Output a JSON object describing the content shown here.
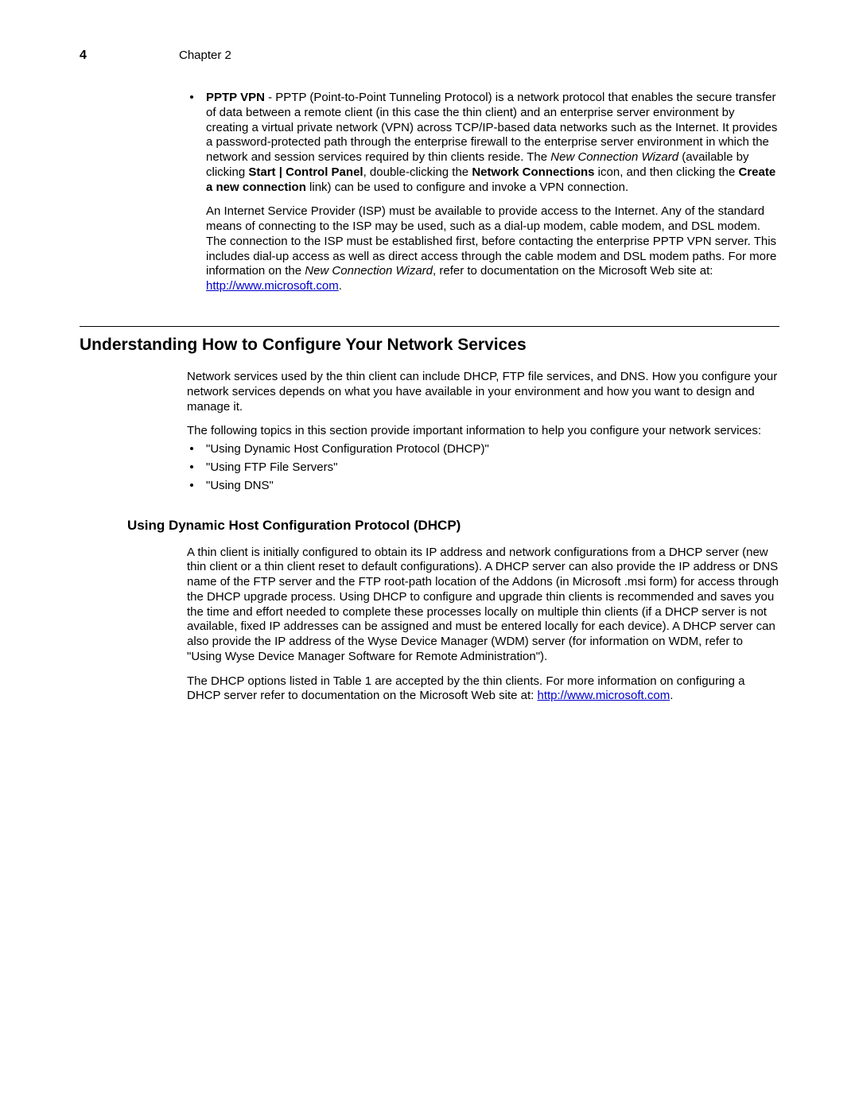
{
  "header": {
    "page_number": "4",
    "chapter_label": "Chapter 2"
  },
  "pptp": {
    "bold_lead": "PPTP VPN",
    "dash": " - ",
    "p1_part1": "PPTP (Point-to-Point Tunneling Protocol) is a network protocol that enables the secure transfer of data between a remote client (in this case the thin client) and an enterprise server environment by creating a virtual private network (VPN) across TCP/IP-based data networks such as the Internet. It provides a password-protected path through the enterprise firewall to the enterprise server environment in which the network and session services required by thin clients reside. The ",
    "italic_wizard": "New Connection Wizard",
    "p1_part2": " (available by clicking ",
    "bold_start_cp": "Start | Control Panel",
    "p1_part3": ", double-clicking the ",
    "bold_netconn": "Network Connections",
    "p1_part4": " icon, and then clicking the ",
    "bold_createnew": "Create a new connection",
    "p1_part5": " link) can be used to configure and invoke a VPN connection.",
    "p2_part1": "An Internet Service Provider (ISP) must be available to provide access to the Internet. Any of the standard means of connecting to the ISP may be used, such as a dial-up modem, cable modem, and DSL modem. The connection to the ISP must be established first, before contacting the enterprise PPTP VPN server. This includes dial-up access as well as direct access through the cable modem and DSL modem paths. For more information on the ",
    "italic_wizard2": "New Connection Wizard",
    "p2_part2": ", refer to documentation on the Microsoft Web site at: ",
    "link1": "http://www.microsoft.com",
    "p2_part3": "."
  },
  "section": {
    "title": "Understanding How to Configure Your Network Services",
    "intro1": "Network services used by the thin client can include DHCP, FTP file services, and DNS. How you configure your network services depends on what you have available in your environment and how you want to design and manage it.",
    "intro2": "The following topics in this section provide important information to help you configure your network services:",
    "topics": [
      "\"Using Dynamic Host Configuration Protocol (DHCP)\"",
      "\"Using FTP File Servers\"",
      "\"Using DNS\""
    ]
  },
  "dhcp": {
    "title": "Using Dynamic Host Configuration Protocol (DHCP)",
    "p1": "A thin client is initially configured to obtain its IP address and network configurations from a DHCP server (new thin client or a thin client reset to default configurations). A DHCP server can also provide the IP address or DNS name of the FTP server and the FTP root-path location of the Addons (in Microsoft .msi form) for access through the DHCP upgrade process. Using DHCP to configure and upgrade thin clients is recommended and saves you the time and effort needed to complete these processes locally on multiple thin clients (if a DHCP server is not available, fixed IP addresses can be assigned and must be entered locally for each device). A DHCP server can also provide the IP address of the Wyse Device Manager (WDM) server (for information on WDM, refer to \"Using Wyse Device Manager Software for Remote Administration\").",
    "p2_part1": "The DHCP options listed in Table 1 are accepted by the thin clients. For more information on configuring a DHCP server refer to documentation on the Microsoft Web site at: ",
    "link2": "http://www.microsoft.com",
    "p2_part2": "."
  }
}
